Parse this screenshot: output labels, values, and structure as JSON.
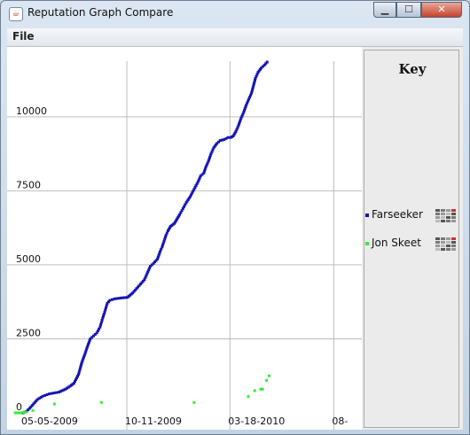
{
  "window": {
    "title": "Reputation Graph Compare",
    "icon": "java-cup-icon",
    "controls": {
      "minimize": "▁",
      "maximize": "☐",
      "close": "✕"
    }
  },
  "menu": {
    "file": "File"
  },
  "colors": {
    "farseeker": "#1414b4",
    "jon_skeet": "#33ee33",
    "grid": "#bdbdbd",
    "axis_text": "#111111"
  },
  "key": {
    "title": "Key",
    "entries": [
      {
        "name": "Farseeker",
        "color": "#1414b4",
        "icon": "color-palette-icon"
      },
      {
        "name": "Jon Skeet",
        "color": "#33ee33",
        "icon": "color-palette-icon"
      }
    ]
  },
  "chart_data": {
    "type": "scatter",
    "title": "",
    "xlabel": "",
    "ylabel": "",
    "grid": true,
    "legend": "right",
    "ylim": [
      0,
      12000
    ],
    "y_ticks": [
      "0",
      "2500",
      "5000",
      "7500",
      "10000"
    ],
    "x_ticks": [
      "05-05-2009",
      "10-11-2009",
      "03-18-2010",
      "08-"
    ],
    "x_tick_positions_days": [
      0,
      159,
      317,
      476
    ],
    "series": [
      {
        "name": "Farseeker",
        "color": "#1414b4",
        "points": [
          [
            0,
            0
          ],
          [
            5,
            50
          ],
          [
            10,
            150
          ],
          [
            16,
            300
          ],
          [
            22,
            450
          ],
          [
            30,
            560
          ],
          [
            40,
            640
          ],
          [
            55,
            700
          ],
          [
            65,
            800
          ],
          [
            72,
            900
          ],
          [
            78,
            1000
          ],
          [
            85,
            1300
          ],
          [
            90,
            1700
          ],
          [
            95,
            2000
          ],
          [
            98,
            2200
          ],
          [
            103,
            2500
          ],
          [
            108,
            2600
          ],
          [
            113,
            2700
          ],
          [
            118,
            2900
          ],
          [
            122,
            3200
          ],
          [
            125,
            3400
          ],
          [
            129,
            3700
          ],
          [
            133,
            3800
          ],
          [
            140,
            3850
          ],
          [
            150,
            3880
          ],
          [
            160,
            3900
          ],
          [
            168,
            4050
          ],
          [
            172,
            4150
          ],
          [
            180,
            4350
          ],
          [
            186,
            4500
          ],
          [
            190,
            4700
          ],
          [
            195,
            4950
          ],
          [
            200,
            5050
          ],
          [
            206,
            5200
          ],
          [
            210,
            5450
          ],
          [
            213,
            5600
          ],
          [
            216,
            5800
          ],
          [
            219,
            6000
          ],
          [
            222,
            6150
          ],
          [
            226,
            6300
          ],
          [
            232,
            6400
          ],
          [
            236,
            6550
          ],
          [
            240,
            6700
          ],
          [
            245,
            6900
          ],
          [
            250,
            7100
          ],
          [
            256,
            7300
          ],
          [
            262,
            7550
          ],
          [
            268,
            7800
          ],
          [
            272,
            8000
          ],
          [
            277,
            8100
          ],
          [
            280,
            8300
          ],
          [
            284,
            8500
          ],
          [
            288,
            8750
          ],
          [
            292,
            8950
          ],
          [
            297,
            9100
          ],
          [
            302,
            9200
          ],
          [
            308,
            9230
          ],
          [
            314,
            9300
          ],
          [
            318,
            9300
          ],
          [
            322,
            9350
          ],
          [
            326,
            9500
          ],
          [
            330,
            9700
          ],
          [
            334,
            9950
          ],
          [
            338,
            10150
          ],
          [
            342,
            10400
          ],
          [
            346,
            10600
          ],
          [
            350,
            10800
          ],
          [
            353,
            11050
          ],
          [
            356,
            11300
          ],
          [
            360,
            11500
          ],
          [
            365,
            11650
          ],
          [
            370,
            11750
          ],
          [
            374,
            11850
          ]
        ]
      },
      {
        "name": "Jon Skeet",
        "color": "#33ee33",
        "points": [
          [
            -12,
            0
          ],
          [
            -8,
            0
          ],
          [
            -4,
            0
          ],
          [
            0,
            20
          ],
          [
            4,
            30
          ],
          [
            15,
            80
          ],
          [
            48,
            300
          ],
          [
            120,
            350
          ],
          [
            262,
            350
          ],
          [
            345,
            550
          ],
          [
            355,
            750
          ],
          [
            364,
            800
          ],
          [
            367,
            800
          ],
          [
            373,
            1100
          ],
          [
            377,
            1250
          ]
        ]
      }
    ]
  }
}
